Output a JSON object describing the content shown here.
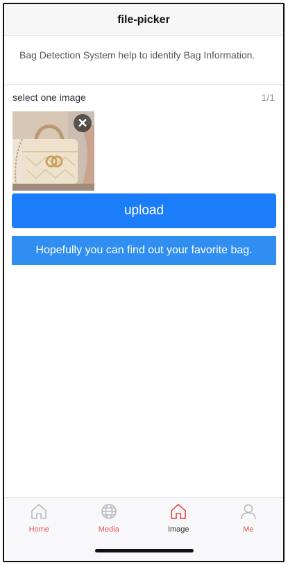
{
  "nav": {
    "title": "file-picker"
  },
  "description": "Bag Detection System help to identify Bag Information.",
  "picker": {
    "label": "select one image",
    "count": "1/1"
  },
  "thumbnail": {
    "close_glyph": "✕"
  },
  "upload": {
    "label": "upload",
    "color": "#1c7dfb"
  },
  "notice": {
    "text": "Hopefully you can find out your favorite bag.",
    "color": "#2f8ef0"
  },
  "tabbar": {
    "items": [
      {
        "label": "Home",
        "icon": "home-icon",
        "color": "#e8574e"
      },
      {
        "label": "Media",
        "icon": "globe-icon",
        "color": "#e8574e"
      },
      {
        "label": "Image",
        "icon": "home-icon",
        "color": "#333333",
        "icon_color": "#e8574e",
        "active": true
      },
      {
        "label": "Me",
        "icon": "person-icon",
        "color": "#e8574e"
      }
    ]
  }
}
